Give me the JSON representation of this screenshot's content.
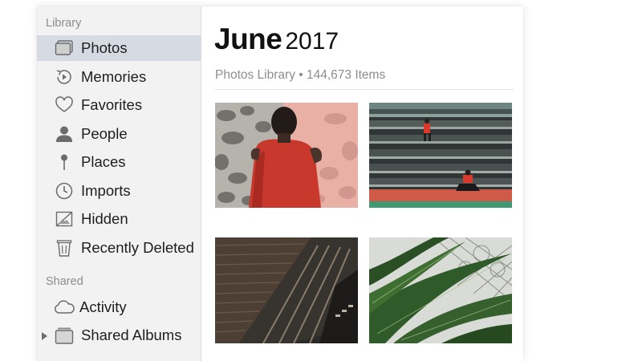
{
  "sidebar": {
    "library_header": "Library",
    "library_items": [
      {
        "label": "Photos",
        "icon": "photos-icon",
        "selected": true
      },
      {
        "label": "Memories",
        "icon": "memories-icon"
      },
      {
        "label": "Favorites",
        "icon": "heart-icon"
      },
      {
        "label": "People",
        "icon": "person-icon"
      },
      {
        "label": "Places",
        "icon": "pin-icon"
      },
      {
        "label": "Imports",
        "icon": "clock-icon"
      },
      {
        "label": "Hidden",
        "icon": "hidden-icon"
      },
      {
        "label": "Recently Deleted",
        "icon": "trash-icon"
      }
    ],
    "shared_header": "Shared",
    "shared_items": [
      {
        "label": "Activity",
        "icon": "cloud-icon"
      },
      {
        "label": "Shared Albums",
        "icon": "album-icon",
        "collapsed": true
      }
    ]
  },
  "main": {
    "title_month": "June",
    "title_year": "2017",
    "subtitle": "Photos Library • 144,673 Items"
  },
  "colors": {
    "sidebar_bg": "#f3f2f3",
    "selection_bg": "#d5dae3",
    "text_primary": "#1e1e1e",
    "text_secondary": "#8d8d8d"
  }
}
